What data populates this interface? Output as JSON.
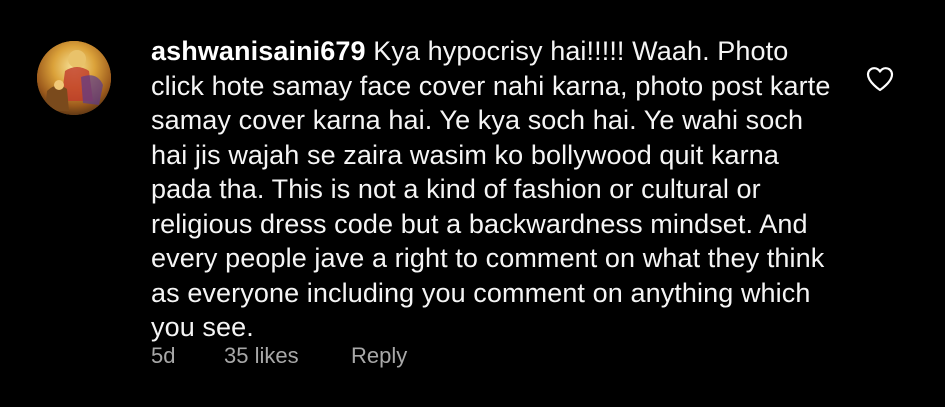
{
  "comment": {
    "username": "ashwanisaini679",
    "text": "Kya hypocrisy hai!!!!! Waah. Photo click hote samay face cover nahi karna, photo post karte samay cover karna hai. Ye kya soch hai. Ye wahi soch hai jis wajah se zaira wasim ko bollywood quit karna pada tha. This is not a kind of fashion or cultural or religious dress code but a backwardness mindset. And every people jave a right to comment on what they think as everyone including you comment on anything which you see.",
    "time": "5d",
    "likes": "35 likes",
    "reply_label": "Reply"
  },
  "icons": {
    "avatar": "avatar-image",
    "like": "heart-icon"
  },
  "colors": {
    "background": "#000000",
    "text": "#f5f5f5",
    "meta": "#a8a8a8"
  }
}
